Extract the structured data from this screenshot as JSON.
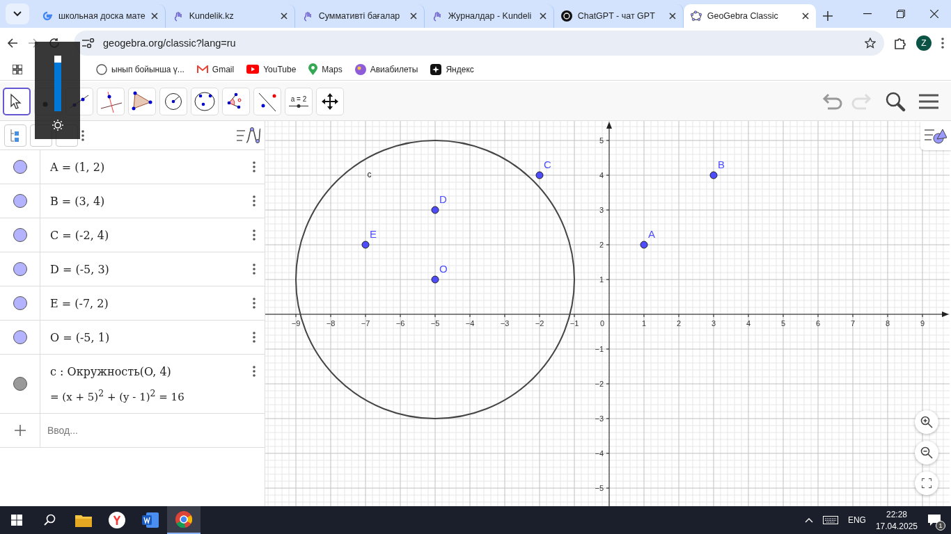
{
  "browser": {
    "tabs": [
      {
        "kind": "google",
        "title": "школьная доска мате",
        "selected": false
      },
      {
        "kind": "kundelik",
        "title": "Kundelik.kz",
        "selected": false
      },
      {
        "kind": "kundelik",
        "title": "Суммативті бағалар",
        "selected": false
      },
      {
        "kind": "kundelik",
        "title": "Журналдар - Kundeli",
        "selected": false
      },
      {
        "kind": "chatgpt",
        "title": "ChatGPT - чат GPT",
        "selected": false
      },
      {
        "kind": "geogebra",
        "title": "GeoGebra Classic",
        "selected": true
      }
    ],
    "url": "geogebra.org/classic?lang=ru",
    "avatar": "Z",
    "bookmarks": [
      {
        "kind": "globe",
        "label": "ынып бойынша ү..."
      },
      {
        "kind": "gmail",
        "label": "Gmail"
      },
      {
        "kind": "youtube",
        "label": "YouTube"
      },
      {
        "kind": "maps",
        "label": "Maps"
      },
      {
        "kind": "planet",
        "label": "Авиабилеты"
      },
      {
        "kind": "yandex",
        "label": "Яндекс"
      }
    ]
  },
  "osd": {
    "level": 0.87
  },
  "toolbar": {
    "tools": [
      {
        "kind": "move",
        "selected": true
      },
      {
        "kind": "point",
        "selected": false
      },
      {
        "kind": "line",
        "selected": false
      },
      {
        "kind": "perpendicular",
        "selected": false
      },
      {
        "kind": "polygon",
        "selected": false
      },
      {
        "kind": "circle",
        "selected": false
      },
      {
        "kind": "conic",
        "selected": false
      },
      {
        "kind": "angle",
        "selected": false
      },
      {
        "kind": "reflect",
        "selected": false
      },
      {
        "kind": "slider",
        "label": "a = 2",
        "selected": false
      },
      {
        "kind": "pan",
        "selected": false
      }
    ]
  },
  "algebra": {
    "items": [
      {
        "kind": "point",
        "text": "A = (1, 2)",
        "color": "#b3b3ff"
      },
      {
        "kind": "point",
        "text": "B = (3, 4)",
        "color": "#b3b3ff"
      },
      {
        "kind": "point",
        "text": "C = (-2, 4)",
        "color": "#b3b3ff"
      },
      {
        "kind": "point",
        "text": "D = (-5, 3)",
        "color": "#b3b3ff"
      },
      {
        "kind": "point",
        "text": "E = (-7, 2)",
        "color": "#b3b3ff"
      },
      {
        "kind": "point",
        "text": "O = (-5, 1)",
        "color": "#b3b3ff"
      },
      {
        "kind": "conic",
        "text": "c : Окружность(O, 4)",
        "value": "=  (x + 5)$^{2}$ + (y - 1)$^{2}$ = 16",
        "color": "#999999"
      }
    ],
    "input": {
      "placeholder": "Ввод..."
    }
  },
  "graphics": {
    "origin_label": "0",
    "chart_data": {
      "type": "scatter",
      "grid": true,
      "xlim": [
        -9.88,
        9.78
      ],
      "ylim": [
        -5.54,
        5.56
      ],
      "xticks": [
        {
          "value": -9,
          "label": "−9"
        },
        {
          "value": -8,
          "label": "−8"
        },
        {
          "value": -7,
          "label": "−7"
        },
        {
          "value": -6,
          "label": "−6"
        },
        {
          "value": -5,
          "label": "−5"
        },
        {
          "value": -4,
          "label": "−4"
        },
        {
          "value": -3,
          "label": "−3"
        },
        {
          "value": -2,
          "label": "−2"
        },
        {
          "value": -1,
          "label": "−1"
        },
        {
          "value": 1,
          "label": "1"
        },
        {
          "value": 2,
          "label": "2"
        },
        {
          "value": 3,
          "label": "3"
        },
        {
          "value": 4,
          "label": "4"
        },
        {
          "value": 5,
          "label": "5"
        },
        {
          "value": 6,
          "label": "6"
        },
        {
          "value": 7,
          "label": "7"
        },
        {
          "value": 8,
          "label": "8"
        },
        {
          "value": 9,
          "label": "9"
        }
      ],
      "yticks": [
        {
          "value": 5,
          "label": "5"
        },
        {
          "value": 4,
          "label": "4"
        },
        {
          "value": 3,
          "label": "3"
        },
        {
          "value": 2,
          "label": "2"
        },
        {
          "value": 1,
          "label": "1"
        },
        {
          "value": -1,
          "label": "−1"
        },
        {
          "value": -2,
          "label": "−2"
        },
        {
          "value": -3,
          "label": "−3"
        },
        {
          "value": -4,
          "label": "−4"
        },
        {
          "value": -5,
          "label": "−5"
        }
      ],
      "series": [
        {
          "color": "#4d4dff",
          "x": [
            1,
            3,
            -2,
            -5,
            -7,
            -5
          ],
          "values": [
            2,
            4,
            4,
            3,
            2,
            1
          ]
        }
      ],
      "annotations": [
        {
          "text": "A",
          "x": 1,
          "y": 2
        },
        {
          "text": "B",
          "x": 3,
          "y": 4
        },
        {
          "text": "C",
          "x": -2,
          "y": 4
        },
        {
          "text": "D",
          "x": -5,
          "y": 3
        },
        {
          "text": "E",
          "x": -7,
          "y": 2
        },
        {
          "text": "O",
          "x": -5,
          "y": 1
        },
        "c"
      ]
    }
  },
  "taskbar": {
    "apps": [
      {
        "kind": "explorer",
        "selected": false
      },
      {
        "kind": "yandex",
        "selected": false
      },
      {
        "kind": "word",
        "selected": false
      },
      {
        "kind": "chrome",
        "selected": true
      }
    ],
    "lang": "ENG",
    "time": "22:28",
    "date": "17.04.2025",
    "notifications": "1"
  }
}
